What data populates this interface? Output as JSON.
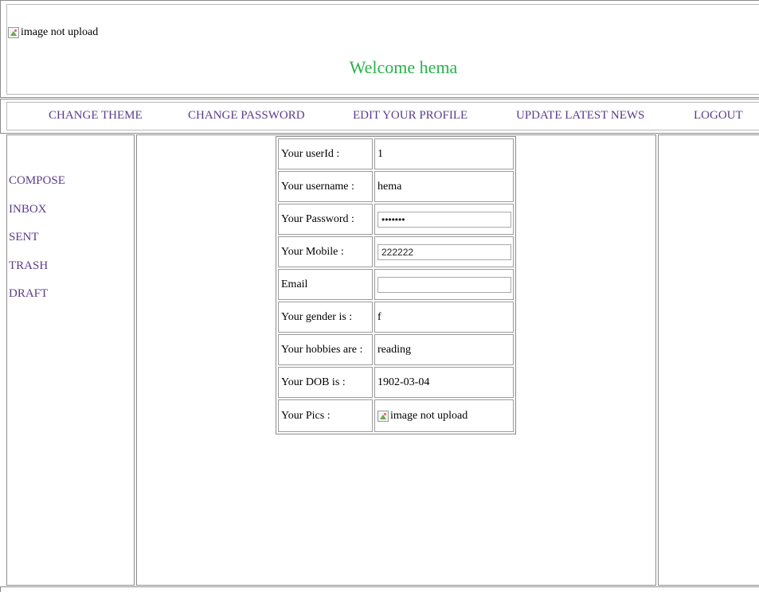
{
  "header": {
    "image_alt": "image not upload",
    "welcome": "Welcome hema"
  },
  "nav": {
    "items": [
      {
        "label": "CHANGE THEME"
      },
      {
        "label": "CHANGE PASSWORD"
      },
      {
        "label": "EDIT YOUR PROFILE"
      },
      {
        "label": "UPDATE LATEST NEWS"
      },
      {
        "label": "LOGOUT"
      }
    ]
  },
  "sidebar": {
    "items": [
      {
        "label": "COMPOSE"
      },
      {
        "label": "INBOX"
      },
      {
        "label": "SENT"
      },
      {
        "label": "TRASH"
      },
      {
        "label": "DRAFT"
      }
    ]
  },
  "profile": {
    "rows": [
      {
        "label": "Your userId :",
        "value": "1"
      },
      {
        "label": "Your username :",
        "value": "hema"
      },
      {
        "label": "Your Password :",
        "value": "•••••••"
      },
      {
        "label": "Your Mobile :",
        "value": "222222"
      },
      {
        "label": "Email",
        "value": ""
      },
      {
        "label": "Your gender is :",
        "value": "f"
      },
      {
        "label": "Your hobbies are :",
        "value": "reading"
      },
      {
        "label": "Your DOB is :",
        "value": "1902-03-04"
      },
      {
        "label": "Your Pics :",
        "value": "image not upload"
      }
    ]
  },
  "colors": {
    "link": "#5a3b8c",
    "welcome": "#27b24a",
    "border": "#8c8c8c"
  },
  "icons": {
    "broken_image": "broken-image-icon"
  }
}
